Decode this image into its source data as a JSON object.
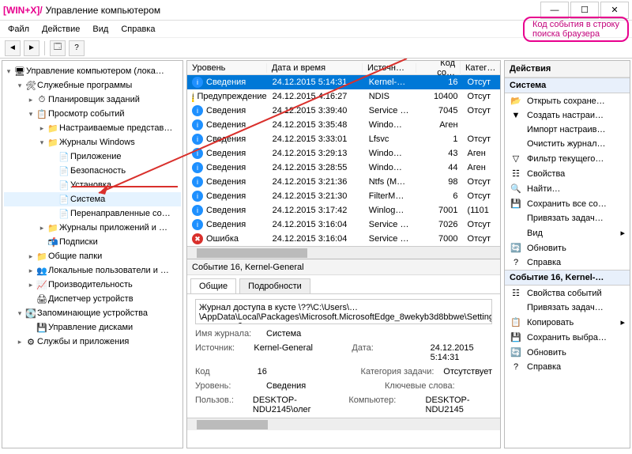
{
  "window": {
    "prefix": "[WIN+X]/",
    "title": "Управление компьютером",
    "btn_min": "—",
    "btn_max": "☐",
    "btn_close": "✕"
  },
  "menu": {
    "file": "Файл",
    "action": "Действие",
    "view": "Вид",
    "help": "Справка"
  },
  "annotation": {
    "line1": "Код события в строку",
    "line2": "поиска браузера"
  },
  "tree": {
    "root": "Управление компьютером (лока…",
    "n1": "Служебные программы",
    "n1a": "Планировщик заданий",
    "n1b": "Просмотр событий",
    "n1b1": "Настраиваемые представ…",
    "n1b2": "Журналы Windows",
    "n1b2a": "Приложение",
    "n1b2b": "Безопасность",
    "n1b2c": "Установка",
    "n1b2d": "Система",
    "n1b2e": "Перенаправленные со…",
    "n1b3": "Журналы приложений и …",
    "n1b4": "Подписки",
    "n1c": "Общие папки",
    "n1d": "Локальные пользователи и …",
    "n1e": "Производительность",
    "n1f": "Диспетчер устройств",
    "n2": "Запоминающие устройства",
    "n2a": "Управление дисками",
    "n3": "Службы и приложения"
  },
  "grid": {
    "headers": {
      "level": "Уровень",
      "date": "Дата и время",
      "src": "Источн…",
      "code": "Код со…",
      "cat": "Катег…"
    },
    "rows": [
      {
        "lvl": "info",
        "level": "Сведения",
        "date": "24.12.2015 5:14:31",
        "src": "Kernel-…",
        "code": "16",
        "cat": "Отсут"
      },
      {
        "lvl": "warn",
        "level": "Предупреждение",
        "date": "24.12.2015 4:16:27",
        "src": "NDIS",
        "code": "10400",
        "cat": "Отсут"
      },
      {
        "lvl": "info",
        "level": "Сведения",
        "date": "24.12.2015 3:39:40",
        "src": "Service …",
        "code": "7045",
        "cat": "Отсут"
      },
      {
        "lvl": "info",
        "level": "Сведения",
        "date": "24.12.2015 3:35:48",
        "src": "Windo…",
        "code": "Аген",
        "cat": ""
      },
      {
        "lvl": "info",
        "level": "Сведения",
        "date": "24.12.2015 3:33:01",
        "src": "Lfsvc",
        "code": "1",
        "cat": "Отсут"
      },
      {
        "lvl": "info",
        "level": "Сведения",
        "date": "24.12.2015 3:29:13",
        "src": "Windo…",
        "code": "43",
        "cat": "Аген"
      },
      {
        "lvl": "info",
        "level": "Сведения",
        "date": "24.12.2015 3:28:55",
        "src": "Windo…",
        "code": "44",
        "cat": "Аген"
      },
      {
        "lvl": "info",
        "level": "Сведения",
        "date": "24.12.2015 3:21:36",
        "src": "Ntfs (M…",
        "code": "98",
        "cat": "Отсут"
      },
      {
        "lvl": "info",
        "level": "Сведения",
        "date": "24.12.2015 3:21:30",
        "src": "FilterM…",
        "code": "6",
        "cat": "Отсут"
      },
      {
        "lvl": "info",
        "level": "Сведения",
        "date": "24.12.2015 3:17:42",
        "src": "Winlog…",
        "code": "7001",
        "cat": "(1101"
      },
      {
        "lvl": "info",
        "level": "Сведения",
        "date": "24.12.2015 3:16:04",
        "src": "Service …",
        "code": "7026",
        "cat": "Отсут"
      },
      {
        "lvl": "err",
        "level": "Ошибка",
        "date": "24.12.2015 3:16:04",
        "src": "Service …",
        "code": "7000",
        "cat": "Отсут"
      }
    ]
  },
  "details": {
    "title": "Событие 16, Kernel-General",
    "tab1": "Общие",
    "tab2": "Подробности",
    "desc": "Журнал доступа в кусте \\??\\C:\\Users\\…\\AppData\\Local\\Packages\\Microsoft.MicrosoftEdge_8wekyb3d8bbwe\\Settings\\settings.dat очищен обновление",
    "k_log": "Имя журнала:",
    "v_log": "Система",
    "k_src": "Источник:",
    "v_src": "Kernel-General",
    "k_date": "Дата:",
    "v_date": "24.12.2015 5:14:31",
    "k_code": "Код",
    "v_code": "16",
    "k_catg": "Категория задачи:",
    "v_catg": "Отсутствует",
    "k_lvl": "Уровень:",
    "v_lvl": "Сведения",
    "k_kw": "Ключевые слова:",
    "v_kw": "",
    "k_user": "Пользов.:",
    "v_user": "DESKTOP-NDU2145\\олег",
    "k_comp": "Компьютер:",
    "v_comp": "DESKTOP-NDU2145"
  },
  "actions": {
    "title": "Действия",
    "group1": "Система",
    "items1": [
      {
        "icon": "📂",
        "label": "Открыть сохране…"
      },
      {
        "icon": "▼",
        "label": "Создать настраи…"
      },
      {
        "icon": "",
        "label": "Импорт настраив…"
      },
      {
        "icon": "",
        "label": "Очистить журнал…"
      },
      {
        "icon": "▽",
        "label": "Фильтр текущего…"
      },
      {
        "icon": "☷",
        "label": "Свойства"
      },
      {
        "icon": "🔍",
        "label": "Найти…"
      },
      {
        "icon": "💾",
        "label": "Сохранить все со…"
      },
      {
        "icon": "",
        "label": "Привязать задач…"
      },
      {
        "icon": "",
        "label": "Вид",
        "arrow": "▸"
      },
      {
        "icon": "🔄",
        "label": "Обновить"
      },
      {
        "icon": "?",
        "label": "Справка"
      }
    ],
    "group2": "Событие 16, Kernel-…",
    "items2": [
      {
        "icon": "☷",
        "label": "Свойства событий"
      },
      {
        "icon": "",
        "label": "Привязать задач…"
      },
      {
        "icon": "📋",
        "label": "Копировать",
        "arrow": "▸"
      },
      {
        "icon": "💾",
        "label": "Сохранить выбра…"
      },
      {
        "icon": "🔄",
        "label": "Обновить"
      },
      {
        "icon": "?",
        "label": "Справка"
      }
    ]
  }
}
